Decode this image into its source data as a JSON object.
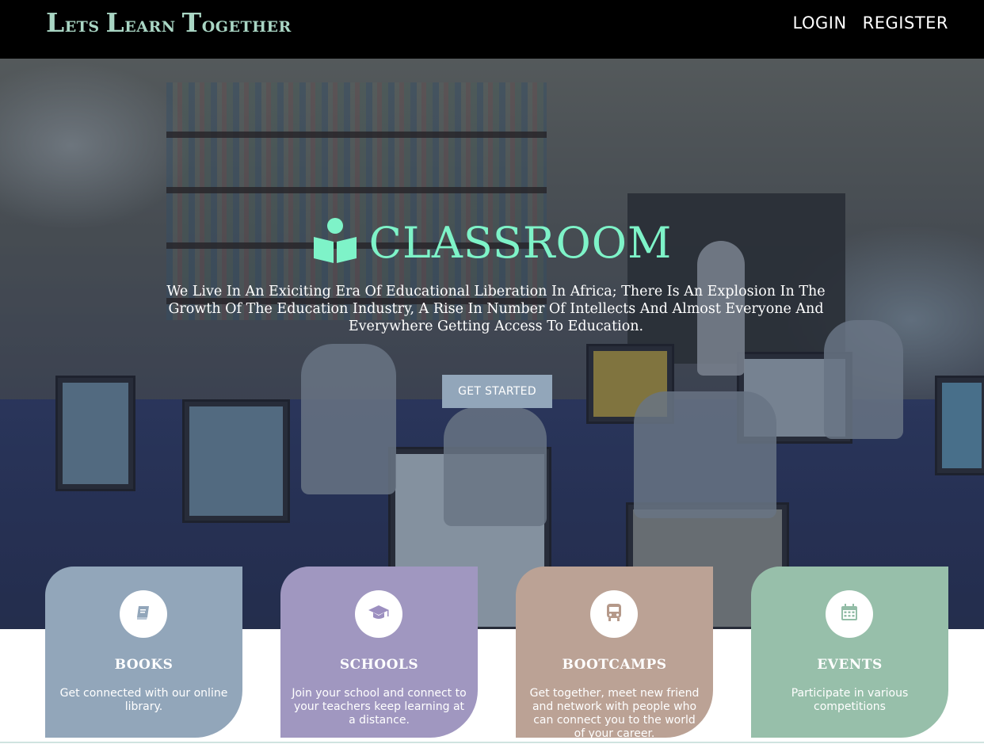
{
  "brand": {
    "word1_cap": "L",
    "word1_rest": "ETS",
    "word2_cap": "L",
    "word2_rest": "EARN",
    "word3_cap": "T",
    "word3_rest": "OGETHER"
  },
  "nav": {
    "login": "LOGIN",
    "register": "REGISTER"
  },
  "hero": {
    "icon": "book-reader-icon",
    "title": "CLASSROOM",
    "text": "We Live In An Exiciting Era Of Educational Liberation In Africa; There Is An Explosion In The Growth Of The Education Industry, A Rise In Number Of Intellects And Almost Everyone And Everywhere Getting Access To Education.",
    "cta": "GET STARTED"
  },
  "cards": [
    {
      "icon": "book-icon",
      "title": "BOOKS",
      "text": "Get connected with our online library.",
      "color": "#92a6ba"
    },
    {
      "icon": "graduation-cap-icon",
      "title": "SCHOOLS",
      "text": "Join your school and connect to your teachers keep learning at a distance.",
      "color": "#a097c0"
    },
    {
      "icon": "bus-icon",
      "title": "BOOTCAMPS",
      "text": "Get together, meet new friend and network with people who can connect you to the world of your career.",
      "color": "#bba295"
    },
    {
      "icon": "calendar-icon",
      "title": "EVENTS",
      "text": "Participate in various competitions",
      "color": "#97bfaa"
    }
  ],
  "colors": {
    "accent": "#7ef3c8",
    "brand": "#a9d6c4",
    "header_bg": "#000000"
  }
}
